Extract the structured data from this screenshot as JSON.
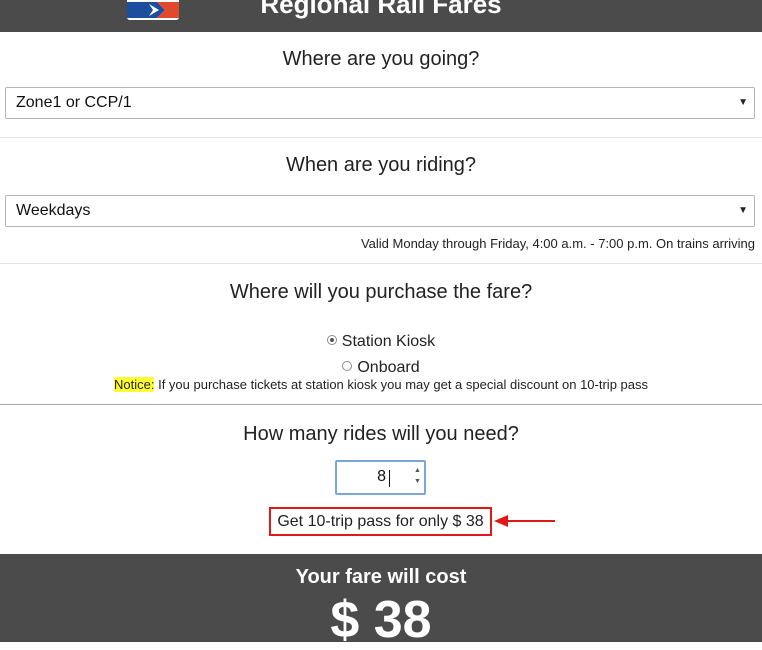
{
  "header": {
    "title": "Regional Rail Fares",
    "logo": "septa-logo"
  },
  "destination": {
    "question": "Where are you going?",
    "selected": "Zone1 or CCP/1"
  },
  "time": {
    "question": "When are you riding?",
    "selected": "Weekdays",
    "note": "Valid Monday through Friday, 4:00 a.m. - 7:00 p.m. On trains arriving"
  },
  "purchase": {
    "question": "Where will you purchase the fare?",
    "options": [
      "Station Kiosk",
      "Onboard"
    ],
    "selected": "Station Kiosk",
    "notice_tag": "Notice:",
    "notice_text": " If you purchase tickets at station kiosk you may get a special discount on 10-trip pass"
  },
  "rides": {
    "question": "How many rides will you need?",
    "value": "8",
    "promo": "Get 10-trip pass for only $ 38"
  },
  "result": {
    "label": "Your fare will cost",
    "amount": "$ 38"
  },
  "colors": {
    "header_bg": "#4b4b4b",
    "highlight_box": "#e01818",
    "notice_highlight": "#ffff33"
  }
}
